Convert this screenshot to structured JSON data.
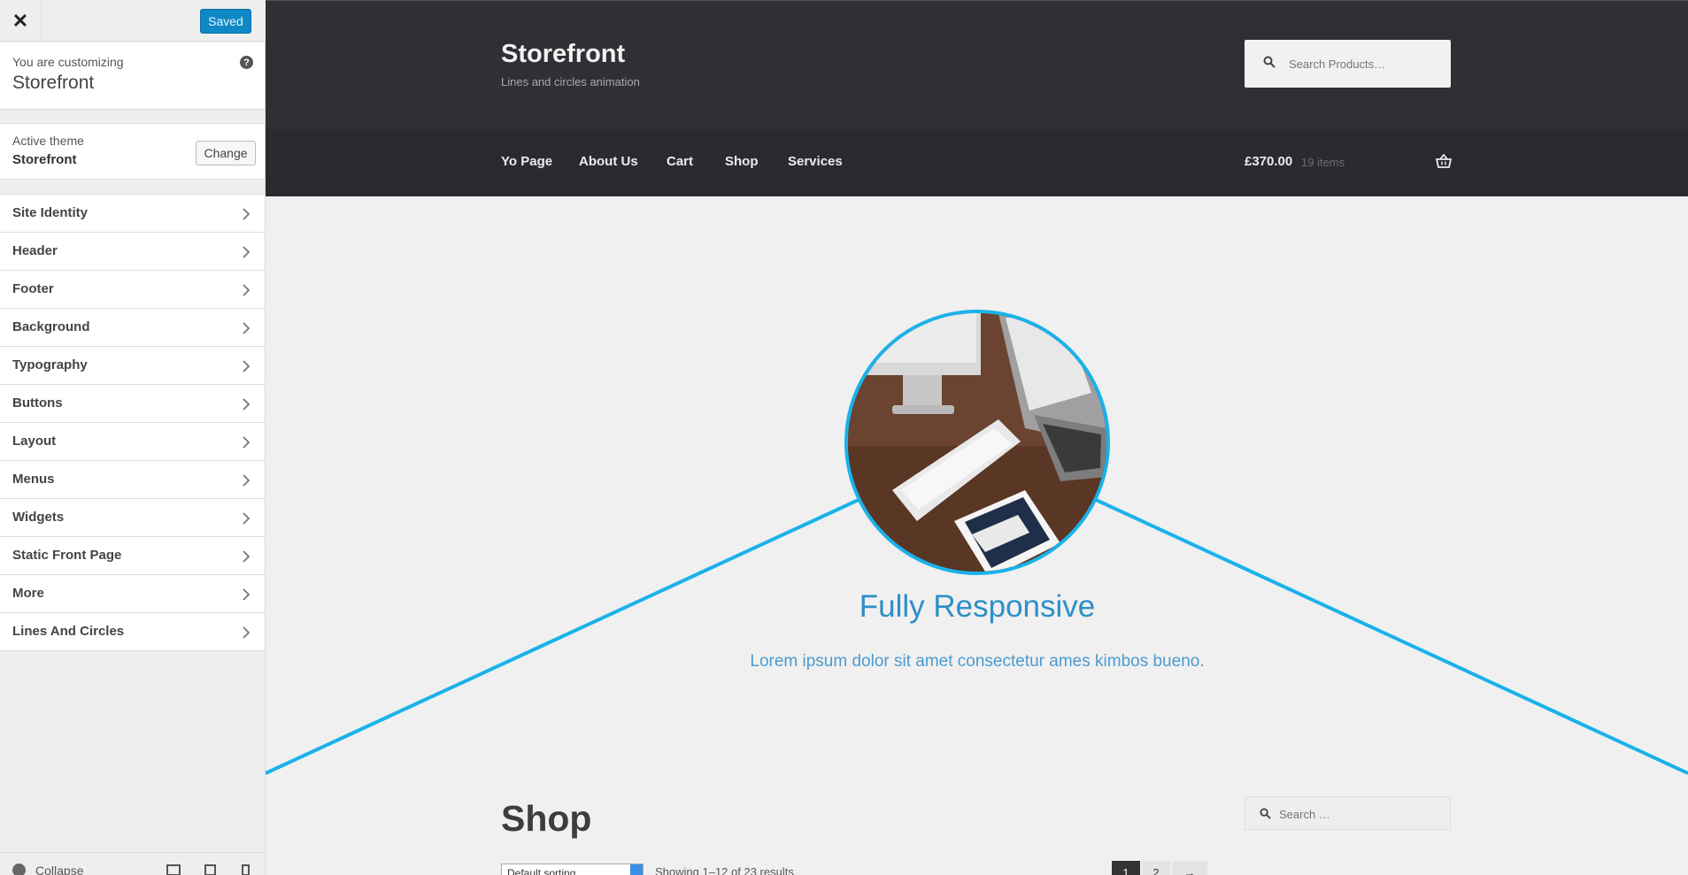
{
  "sidebar": {
    "close_icon": "close-icon",
    "saved_label": "Saved",
    "customizing_label": "You are customizing",
    "customizing_title": "Storefront",
    "help_icon_glyph": "?",
    "active_theme_label": "Active theme",
    "active_theme_name": "Storefront",
    "change_label": "Change",
    "panels": [
      {
        "label": "Site Identity"
      },
      {
        "label": "Header"
      },
      {
        "label": "Footer"
      },
      {
        "label": "Background"
      },
      {
        "label": "Typography"
      },
      {
        "label": "Buttons"
      },
      {
        "label": "Layout"
      },
      {
        "label": "Menus"
      },
      {
        "label": "Widgets"
      },
      {
        "label": "Static Front Page"
      },
      {
        "label": "More"
      },
      {
        "label": "Lines And Circles"
      }
    ],
    "collapse_label": "Collapse",
    "accent_color": "#0e88c6"
  },
  "site": {
    "title": "Storefront",
    "description": "Lines and circles animation",
    "search_placeholder": "Search Products…",
    "nav": [
      "Yo Page",
      "About Us",
      "Cart",
      "Shop",
      "Services"
    ],
    "cart_total": "£370.00",
    "cart_count": "19 items",
    "header_bg": "#2f2f35"
  },
  "hero": {
    "heading": "Fully Responsive",
    "text": "Lorem ipsum dolor sit amet consectetur ames kimbos bueno.",
    "line_color": "#19b2ea"
  },
  "shop": {
    "title": "Shop",
    "search_placeholder": "Search …",
    "sort_value": "Default sorting",
    "result_count": "Showing 1–12 of 23 results",
    "pages": [
      "1",
      "2",
      "→"
    ]
  }
}
